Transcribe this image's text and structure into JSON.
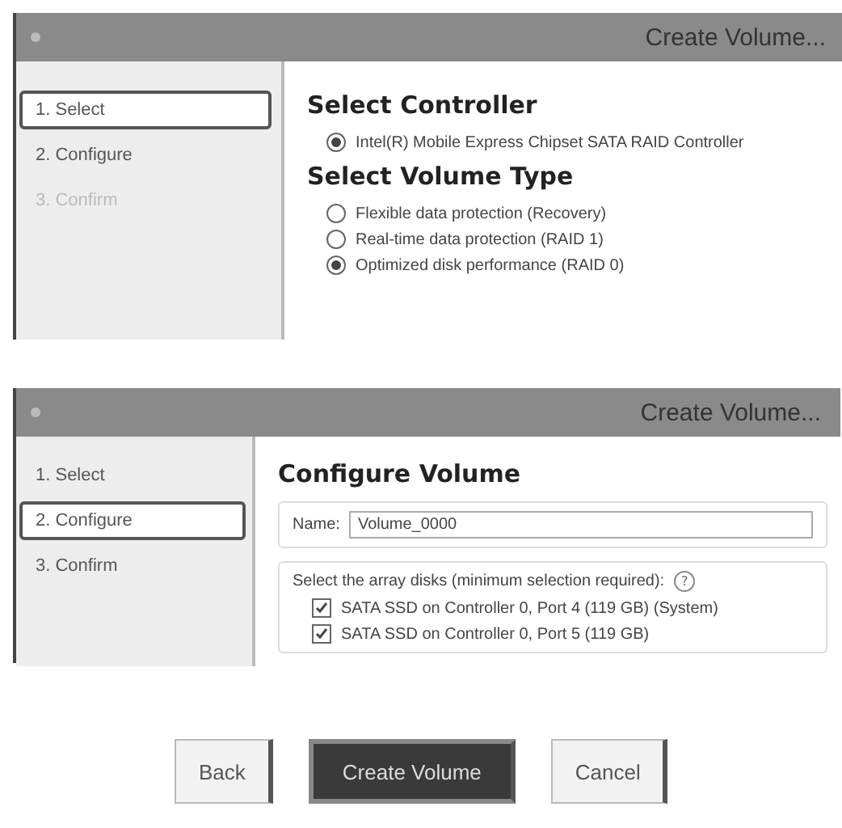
{
  "dialogs": [
    {
      "title": "Create Volume...",
      "steps": [
        {
          "label": "1. Select",
          "selected": true,
          "disabled": false
        },
        {
          "label": "2. Configure",
          "selected": false,
          "disabled": false
        },
        {
          "label": "3. Confirm",
          "selected": false,
          "disabled": true
        }
      ],
      "blocks": [
        {
          "kind": "heading",
          "text": "Select Controller"
        },
        {
          "kind": "radios",
          "options": [
            {
              "label": "Intel(R) Mobile Express Chipset SATA RAID Controller",
              "selected": true
            }
          ]
        },
        {
          "kind": "heading",
          "text": "Select Volume Type"
        },
        {
          "kind": "radios",
          "options": [
            {
              "label": "Flexible data protection (Recovery)",
              "selected": false
            },
            {
              "label": "Real-time data protection (RAID 1)",
              "selected": false
            },
            {
              "label": "Optimized disk performance (RAID 0)",
              "selected": true
            }
          ]
        }
      ]
    },
    {
      "title": "Create Volume...",
      "steps": [
        {
          "label": "1. Select",
          "selected": false,
          "disabled": false
        },
        {
          "label": "2. Configure",
          "selected": true,
          "disabled": false
        },
        {
          "label": "3. Confirm",
          "selected": false,
          "disabled": false
        }
      ],
      "blocks": [
        {
          "kind": "heading",
          "text": "Configure Volume"
        },
        {
          "kind": "name",
          "label": "Name:",
          "value": "Volume_0000"
        },
        {
          "kind": "disks",
          "prompt": "Select the array disks (minimum selection required):",
          "help": "?",
          "disks": [
            {
              "label": "SATA SSD on Controller 0, Port 4 (119 GB) (System)",
              "checked": true
            },
            {
              "label": "SATA SSD on Controller 0, Port 5 (119 GB)",
              "checked": true
            }
          ]
        }
      ]
    }
  ],
  "buttons": [
    {
      "label": "Back",
      "primary": false
    },
    {
      "label": "Create Volume",
      "primary": true
    },
    {
      "label": "Cancel",
      "primary": false
    }
  ]
}
